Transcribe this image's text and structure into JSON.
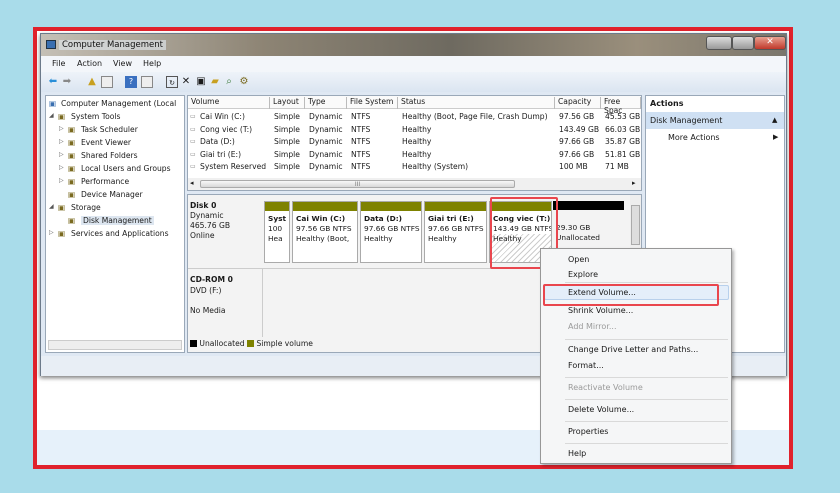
{
  "window": {
    "title": "Computer Management"
  },
  "menu": [
    "File",
    "Action",
    "View",
    "Help"
  ],
  "tree": {
    "root": "Computer Management (Local",
    "items": [
      {
        "label": "System Tools",
        "level": 1,
        "expander": "expanded"
      },
      {
        "label": "Task Scheduler",
        "level": 2,
        "expander": "collapsed"
      },
      {
        "label": "Event Viewer",
        "level": 2,
        "expander": "collapsed"
      },
      {
        "label": "Shared Folders",
        "level": 2,
        "expander": "collapsed"
      },
      {
        "label": "Local Users and Groups",
        "level": 2,
        "expander": "collapsed"
      },
      {
        "label": "Performance",
        "level": 2,
        "expander": "collapsed"
      },
      {
        "label": "Device Manager",
        "level": 2,
        "expander": "none"
      },
      {
        "label": "Storage",
        "level": 1,
        "expander": "expanded"
      },
      {
        "label": "Disk Management",
        "level": 2,
        "expander": "none",
        "selected": true
      },
      {
        "label": "Services and Applications",
        "level": 1,
        "expander": "collapsed"
      }
    ]
  },
  "volumes": {
    "columns": [
      "Volume",
      "Layout",
      "Type",
      "File System",
      "Status",
      "Capacity",
      "Free Spac"
    ],
    "rows": [
      [
        "Cai Win (C:)",
        "Simple",
        "Dynamic",
        "NTFS",
        "Healthy (Boot, Page File, Crash Dump)",
        "97.56 GB",
        "45.53 GB"
      ],
      [
        "Cong viec (T:)",
        "Simple",
        "Dynamic",
        "NTFS",
        "Healthy",
        "143.49 GB",
        "66.03 GB"
      ],
      [
        "Data (D:)",
        "Simple",
        "Dynamic",
        "NTFS",
        "Healthy",
        "97.66 GB",
        "35.87 GB"
      ],
      [
        "Giai tri (E:)",
        "Simple",
        "Dynamic",
        "NTFS",
        "Healthy",
        "97.66 GB",
        "51.81 GB"
      ],
      [
        "System Reserved",
        "Simple",
        "Dynamic",
        "NTFS",
        "Healthy (System)",
        "100 MB",
        "71 MB"
      ]
    ],
    "scroll_mark": "III"
  },
  "disk0": {
    "name": "Disk 0",
    "type": "Dynamic",
    "size": "465.76 GB",
    "status": "Online",
    "partitions": [
      {
        "name": "Syst",
        "size": "100",
        "status": "Hea"
      },
      {
        "name": "Cai Win  (C:)",
        "size": "97.56 GB NTFS",
        "status": "Healthy (Boot,"
      },
      {
        "name": "Data  (D:)",
        "size": "97.66 GB NTFS",
        "status": "Healthy"
      },
      {
        "name": "Giai tri  (E:)",
        "size": "97.66 GB NTFS",
        "status": "Healthy"
      },
      {
        "name": "Cong viec  (T:)",
        "size": "143.49 GB NTFS",
        "status": "Healthy"
      }
    ],
    "unallocated": {
      "size": "29.30 GB",
      "status": "Unallocated"
    }
  },
  "cdrom": {
    "name": "CD-ROM 0",
    "type": "DVD (F:)",
    "status": "No Media"
  },
  "legend": [
    {
      "label": "Unallocated",
      "color": "#000000"
    },
    {
      "label": "Simple volume",
      "color": "#7e8200"
    }
  ],
  "actions": {
    "title": "Actions",
    "section": "Disk Management",
    "more": "More Actions"
  },
  "context_menu": [
    {
      "label": "Open",
      "enabled": true
    },
    {
      "label": "Explore",
      "enabled": true
    },
    {
      "label": "Extend Volume...",
      "enabled": true,
      "highlighted": true
    },
    {
      "label": "Shrink Volume...",
      "enabled": true
    },
    {
      "label": "Add Mirror...",
      "enabled": false
    },
    {
      "label": "Change Drive Letter and Paths...",
      "enabled": true
    },
    {
      "label": "Format...",
      "enabled": true
    },
    {
      "label": "Reactivate Volume",
      "enabled": false
    },
    {
      "label": "Delete Volume...",
      "enabled": true
    },
    {
      "label": "Properties",
      "enabled": true
    },
    {
      "label": "Help",
      "enabled": true
    }
  ],
  "colors": {
    "frame": "#e0222c",
    "background": "#a9dcea",
    "simple_volume": "#7e8200"
  }
}
